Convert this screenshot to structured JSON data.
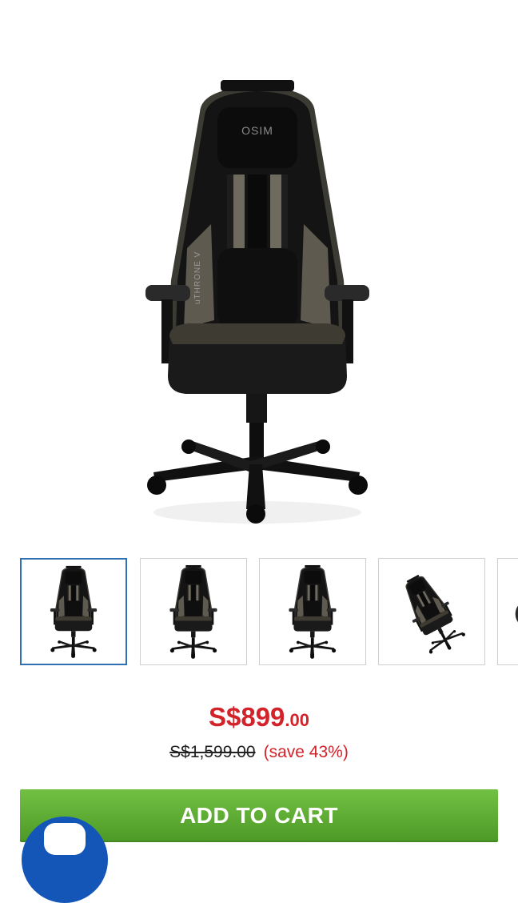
{
  "product": {
    "main_image_alt": "OSIM uThrone V gaming massage chair",
    "brand_mark": "OSIM",
    "side_mark": "uTHRONE V"
  },
  "gallery": {
    "thumbnails": [
      {
        "view": "front",
        "selected": true
      },
      {
        "view": "three-quarter",
        "selected": false
      },
      {
        "view": "back",
        "selected": false
      },
      {
        "view": "reclined",
        "selected": false
      },
      {
        "view": "more",
        "selected": false
      }
    ]
  },
  "pricing": {
    "current_main": "S$899",
    "current_cents": ".00",
    "original": "S$1,599.00",
    "savings": "(save 43%)"
  },
  "actions": {
    "add_to_cart_label": "ADD TO CART"
  },
  "chat": {
    "icon": "chat-icon"
  },
  "colors": {
    "price_red": "#d2232a",
    "cart_green": "#5aaa30",
    "selected_border": "#2f6fb5",
    "chat_blue": "#1456b8"
  }
}
